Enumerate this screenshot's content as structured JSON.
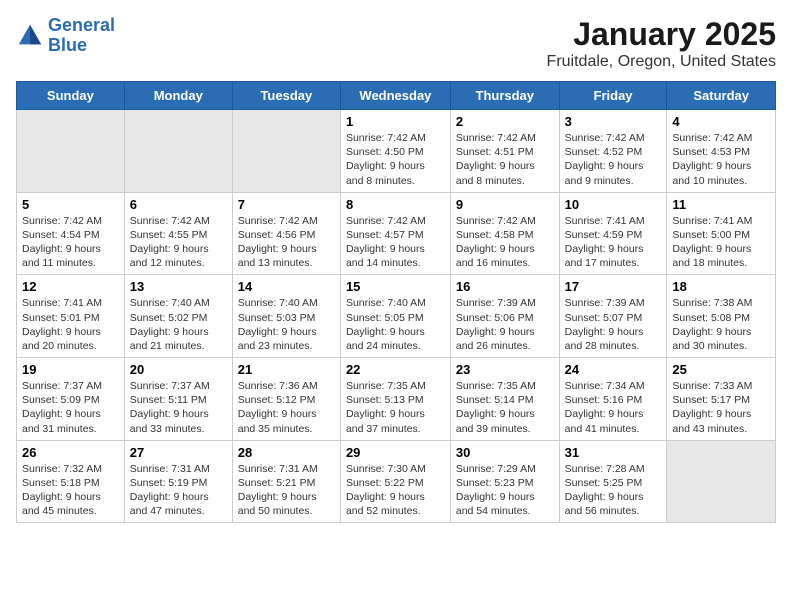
{
  "header": {
    "logo_line1": "General",
    "logo_line2": "Blue",
    "title": "January 2025",
    "subtitle": "Fruitdale, Oregon, United States"
  },
  "weekdays": [
    "Sunday",
    "Monday",
    "Tuesday",
    "Wednesday",
    "Thursday",
    "Friday",
    "Saturday"
  ],
  "weeks": [
    [
      {
        "day": "",
        "info": "",
        "empty": true
      },
      {
        "day": "",
        "info": "",
        "empty": true
      },
      {
        "day": "",
        "info": "",
        "empty": true
      },
      {
        "day": "1",
        "info": "Sunrise: 7:42 AM\nSunset: 4:50 PM\nDaylight: 9 hours and 8 minutes."
      },
      {
        "day": "2",
        "info": "Sunrise: 7:42 AM\nSunset: 4:51 PM\nDaylight: 9 hours and 8 minutes."
      },
      {
        "day": "3",
        "info": "Sunrise: 7:42 AM\nSunset: 4:52 PM\nDaylight: 9 hours and 9 minutes."
      },
      {
        "day": "4",
        "info": "Sunrise: 7:42 AM\nSunset: 4:53 PM\nDaylight: 9 hours and 10 minutes."
      }
    ],
    [
      {
        "day": "5",
        "info": "Sunrise: 7:42 AM\nSunset: 4:54 PM\nDaylight: 9 hours and 11 minutes."
      },
      {
        "day": "6",
        "info": "Sunrise: 7:42 AM\nSunset: 4:55 PM\nDaylight: 9 hours and 12 minutes."
      },
      {
        "day": "7",
        "info": "Sunrise: 7:42 AM\nSunset: 4:56 PM\nDaylight: 9 hours and 13 minutes."
      },
      {
        "day": "8",
        "info": "Sunrise: 7:42 AM\nSunset: 4:57 PM\nDaylight: 9 hours and 14 minutes."
      },
      {
        "day": "9",
        "info": "Sunrise: 7:42 AM\nSunset: 4:58 PM\nDaylight: 9 hours and 16 minutes."
      },
      {
        "day": "10",
        "info": "Sunrise: 7:41 AM\nSunset: 4:59 PM\nDaylight: 9 hours and 17 minutes."
      },
      {
        "day": "11",
        "info": "Sunrise: 7:41 AM\nSunset: 5:00 PM\nDaylight: 9 hours and 18 minutes."
      }
    ],
    [
      {
        "day": "12",
        "info": "Sunrise: 7:41 AM\nSunset: 5:01 PM\nDaylight: 9 hours and 20 minutes."
      },
      {
        "day": "13",
        "info": "Sunrise: 7:40 AM\nSunset: 5:02 PM\nDaylight: 9 hours and 21 minutes."
      },
      {
        "day": "14",
        "info": "Sunrise: 7:40 AM\nSunset: 5:03 PM\nDaylight: 9 hours and 23 minutes."
      },
      {
        "day": "15",
        "info": "Sunrise: 7:40 AM\nSunset: 5:05 PM\nDaylight: 9 hours and 24 minutes."
      },
      {
        "day": "16",
        "info": "Sunrise: 7:39 AM\nSunset: 5:06 PM\nDaylight: 9 hours and 26 minutes."
      },
      {
        "day": "17",
        "info": "Sunrise: 7:39 AM\nSunset: 5:07 PM\nDaylight: 9 hours and 28 minutes."
      },
      {
        "day": "18",
        "info": "Sunrise: 7:38 AM\nSunset: 5:08 PM\nDaylight: 9 hours and 30 minutes."
      }
    ],
    [
      {
        "day": "19",
        "info": "Sunrise: 7:37 AM\nSunset: 5:09 PM\nDaylight: 9 hours and 31 minutes."
      },
      {
        "day": "20",
        "info": "Sunrise: 7:37 AM\nSunset: 5:11 PM\nDaylight: 9 hours and 33 minutes."
      },
      {
        "day": "21",
        "info": "Sunrise: 7:36 AM\nSunset: 5:12 PM\nDaylight: 9 hours and 35 minutes."
      },
      {
        "day": "22",
        "info": "Sunrise: 7:35 AM\nSunset: 5:13 PM\nDaylight: 9 hours and 37 minutes."
      },
      {
        "day": "23",
        "info": "Sunrise: 7:35 AM\nSunset: 5:14 PM\nDaylight: 9 hours and 39 minutes."
      },
      {
        "day": "24",
        "info": "Sunrise: 7:34 AM\nSunset: 5:16 PM\nDaylight: 9 hours and 41 minutes."
      },
      {
        "day": "25",
        "info": "Sunrise: 7:33 AM\nSunset: 5:17 PM\nDaylight: 9 hours and 43 minutes."
      }
    ],
    [
      {
        "day": "26",
        "info": "Sunrise: 7:32 AM\nSunset: 5:18 PM\nDaylight: 9 hours and 45 minutes."
      },
      {
        "day": "27",
        "info": "Sunrise: 7:31 AM\nSunset: 5:19 PM\nDaylight: 9 hours and 47 minutes."
      },
      {
        "day": "28",
        "info": "Sunrise: 7:31 AM\nSunset: 5:21 PM\nDaylight: 9 hours and 50 minutes."
      },
      {
        "day": "29",
        "info": "Sunrise: 7:30 AM\nSunset: 5:22 PM\nDaylight: 9 hours and 52 minutes."
      },
      {
        "day": "30",
        "info": "Sunrise: 7:29 AM\nSunset: 5:23 PM\nDaylight: 9 hours and 54 minutes."
      },
      {
        "day": "31",
        "info": "Sunrise: 7:28 AM\nSunset: 5:25 PM\nDaylight: 9 hours and 56 minutes."
      },
      {
        "day": "",
        "info": "",
        "empty": true
      }
    ]
  ]
}
